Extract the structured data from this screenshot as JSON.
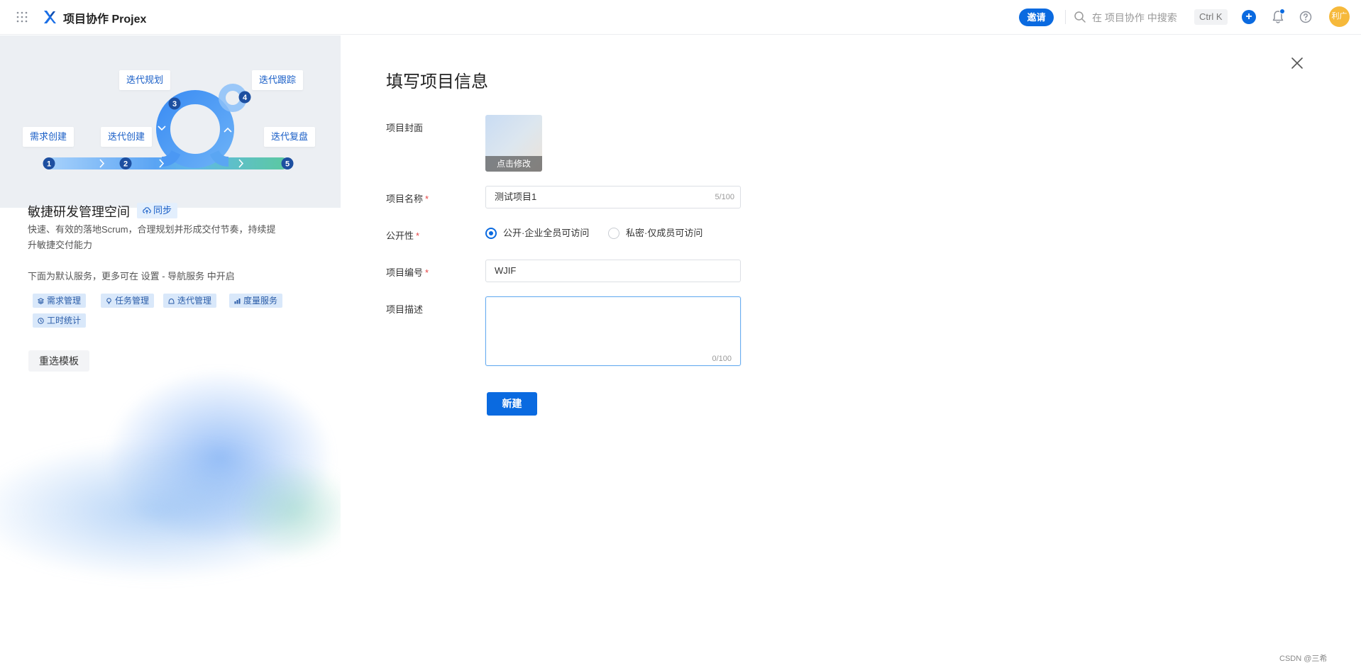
{
  "topbar": {
    "brand": "项目协作 Projex",
    "invite": "邀请",
    "search_placeholder": "在 项目协作 中搜索",
    "shortcut": "Ctrl K",
    "plus": "+",
    "avatar": "利广",
    "accent": "#0a6ae0"
  },
  "hero": {
    "steps": [
      {
        "num": "1",
        "label": "需求创建"
      },
      {
        "num": "2",
        "label": "迭代创建"
      },
      {
        "num": "3",
        "label": "迭代规划"
      },
      {
        "num": "4",
        "label": "迭代跟踪"
      },
      {
        "num": "5",
        "label": "迭代复盘"
      }
    ]
  },
  "template": {
    "title": "敏捷研发管理空间",
    "sync": "同步",
    "description": "快速、有效的落地Scrum，合理规划并形成交付节奏，持续提升敏捷交付能力",
    "services_hint": "下面为默认服务，更多可在 设置 - 导航服务 中开启",
    "services": [
      "需求管理",
      "任务管理",
      "迭代管理",
      "度量服务",
      "工时统计"
    ],
    "reselect": "重选模板"
  },
  "form": {
    "title": "填写项目信息",
    "cover_label": "项目封面",
    "cover_action": "点击修改",
    "name_label": "项目名称",
    "name_value": "测试项目1",
    "name_counter": "5/100",
    "visibility_label": "公开性",
    "visibility_options": [
      "公开·企业全员可访问",
      "私密·仅成员可访问"
    ],
    "visibility_selected": "公开·企业全员可访问",
    "code_label": "项目编号",
    "code_value": "WJIF",
    "desc_label": "项目描述",
    "desc_counter": "0/100",
    "required_mark": "*",
    "submit": "新建"
  },
  "watermark": "CSDN @三希"
}
